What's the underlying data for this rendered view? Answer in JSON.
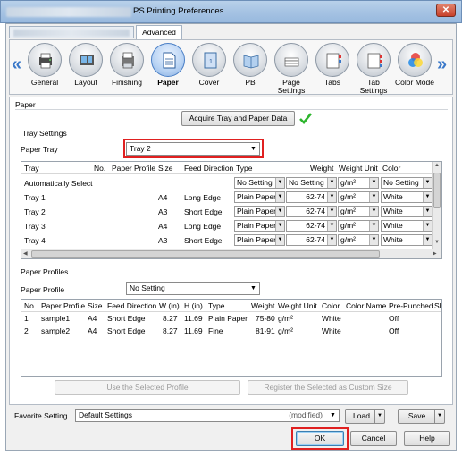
{
  "window": {
    "title": "PS Printing Preferences",
    "close": "✕"
  },
  "tabs": [
    {
      "label": ""
    },
    {
      "label": "Advanced"
    }
  ],
  "nav_left": "«",
  "nav_right": "»",
  "icons": [
    {
      "label": "General",
      "icon": "printer-icon"
    },
    {
      "label": "Layout",
      "icon": "layout-icon"
    },
    {
      "label": "Finishing",
      "icon": "finishing-icon"
    },
    {
      "label": "Paper",
      "icon": "paper-icon"
    },
    {
      "label": "Cover",
      "icon": "cover-icon"
    },
    {
      "label": "PB",
      "icon": "book-icon"
    },
    {
      "label": "Page Settings",
      "icon": "page-settings-icon"
    },
    {
      "label": "Tabs",
      "icon": "tabs-icon"
    },
    {
      "label": "Tab Settings",
      "icon": "tab-settings-icon"
    },
    {
      "label": "Color Mode",
      "icon": "color-mode-icon"
    }
  ],
  "paper": {
    "section": "Paper",
    "acquire_button": "Acquire Tray and Paper Data",
    "tray_settings": "Tray Settings",
    "paper_tray_label": "Paper Tray",
    "paper_tray_value": "Tray 2",
    "tray_table": {
      "headers": [
        "Tray",
        "No.",
        "Paper Profile",
        "Size",
        "Feed Direction",
        "Type",
        "Weight",
        "Weight Unit",
        "Color"
      ],
      "rows": [
        {
          "tray": "Automatically Select",
          "no": "",
          "profile": "",
          "size": "",
          "feed": "",
          "type": "No Setting",
          "weight": "No Setting",
          "unit": "g/m²",
          "color": "No Setting"
        },
        {
          "tray": "Tray 1",
          "no": "",
          "profile": "",
          "size": "A4",
          "feed": "Long Edge",
          "type": "Plain Paper",
          "weight": "62-74",
          "unit": "g/m²",
          "color": "White"
        },
        {
          "tray": "Tray 2",
          "no": "",
          "profile": "",
          "size": "A3",
          "feed": "Short Edge",
          "type": "Plain Paper",
          "weight": "62-74",
          "unit": "g/m²",
          "color": "White"
        },
        {
          "tray": "Tray 3",
          "no": "",
          "profile": "",
          "size": "A4",
          "feed": "Long Edge",
          "type": "Plain Paper",
          "weight": "62-74",
          "unit": "g/m²",
          "color": "White"
        },
        {
          "tray": "Tray 4",
          "no": "",
          "profile": "",
          "size": "A3",
          "feed": "Short Edge",
          "type": "Plain Paper",
          "weight": "62-74",
          "unit": "g/m²",
          "color": "White"
        }
      ]
    },
    "profiles_section": "Paper Profiles",
    "paper_profile_label": "Paper Profile",
    "paper_profile_value": "No Setting",
    "profile_table": {
      "headers": [
        "No.",
        "Paper Profile",
        "Size",
        "Feed Direction",
        "W (in)",
        "H (in)",
        "Type",
        "Weight",
        "Weight Unit",
        "Color",
        "Color Name",
        "Pre-Punched",
        "Sh"
      ],
      "rows": [
        {
          "no": "1",
          "profile": "sample1",
          "size": "A4",
          "feed": "Short Edge",
          "w": "8.27",
          "h": "11.69",
          "type": "Plain Paper",
          "weight": "75-80",
          "unit": "g/m²",
          "color": "White",
          "color_name": "",
          "prepunched": "Off"
        },
        {
          "no": "2",
          "profile": "sample2",
          "size": "A4",
          "feed": "Short Edge",
          "w": "8.27",
          "h": "11.69",
          "type": "Fine",
          "weight": "81-91",
          "unit": "g/m²",
          "color": "White",
          "color_name": "",
          "prepunched": "Off"
        }
      ]
    },
    "use_selected": "Use the Selected Profile",
    "register_selected": "Register the Selected as Custom Size"
  },
  "footer": {
    "favorite_label": "Favorite Setting",
    "favorite_value": "Default Settings",
    "modified": "(modified)",
    "load": "Load",
    "save": "Save",
    "ok": "OK",
    "cancel": "Cancel",
    "help": "Help"
  },
  "colors": {
    "accent": "#3a78c9",
    "highlight": "#e02020",
    "check": "#2db52d"
  }
}
